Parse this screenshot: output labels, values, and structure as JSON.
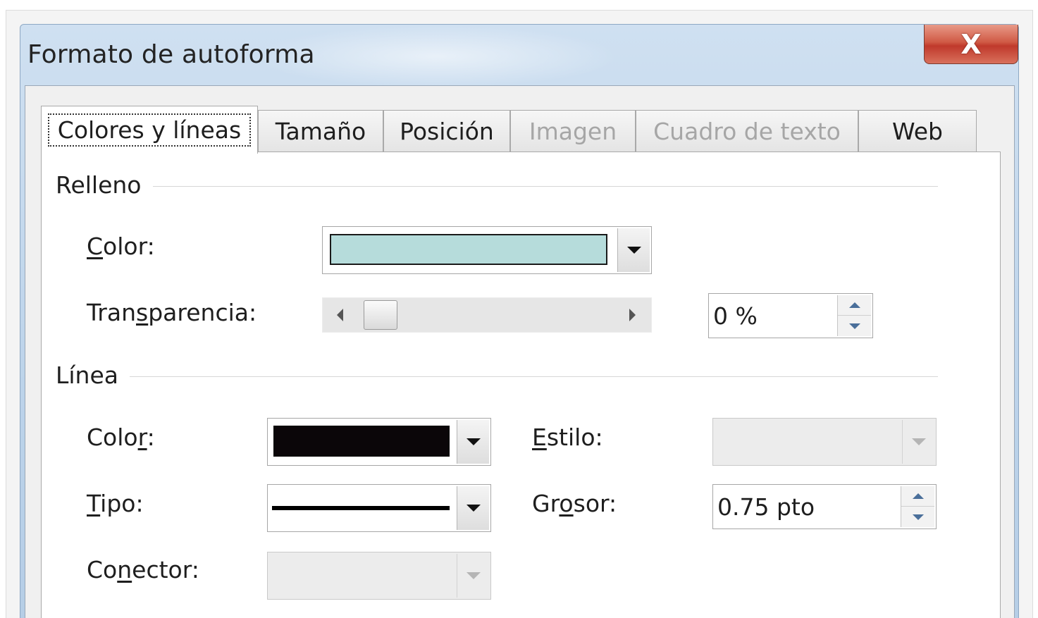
{
  "window": {
    "title": "Formato de autoforma",
    "close_glyph": "X"
  },
  "tabs": [
    {
      "label": "Colores y líneas",
      "active": true,
      "disabled": false
    },
    {
      "label": "Tamaño",
      "active": false,
      "disabled": false
    },
    {
      "label": "Posición",
      "active": false,
      "disabled": false
    },
    {
      "label": "Imagen",
      "active": false,
      "disabled": true
    },
    {
      "label": "Cuadro de texto",
      "active": false,
      "disabled": true
    },
    {
      "label": "Web",
      "active": false,
      "disabled": false
    }
  ],
  "fill": {
    "section_title": "Relleno",
    "color_label": {
      "pre": "",
      "key": "C",
      "post": "olor:"
    },
    "color_value": "#b6dcdb",
    "transparency_label": {
      "pre": "Tran",
      "key": "s",
      "post": "parencia:"
    },
    "transparency_level": 0,
    "transparency_value": "0 %"
  },
  "line": {
    "section_title": "Línea",
    "color_label": {
      "pre": "Colo",
      "key": "r",
      "post": ":"
    },
    "color_value": "#0b0609",
    "type_label": {
      "pre": "",
      "key": "T",
      "post": "ipo:"
    },
    "style_label": {
      "pre": "",
      "key": "E",
      "post": "stilo:"
    },
    "weight_label": {
      "pre": "Gr",
      "key": "o",
      "post": "sor:"
    },
    "weight_value": "0.75 pto",
    "connector_label": {
      "pre": "Co",
      "key": "n",
      "post": "ector:"
    }
  },
  "icons": {
    "close": "close-icon",
    "dropdown": "chevron-down-icon",
    "spin_up": "chevron-up-icon",
    "spin_down": "chevron-down-icon",
    "scroll_left": "caret-left-icon",
    "scroll_right": "caret-right-icon"
  }
}
